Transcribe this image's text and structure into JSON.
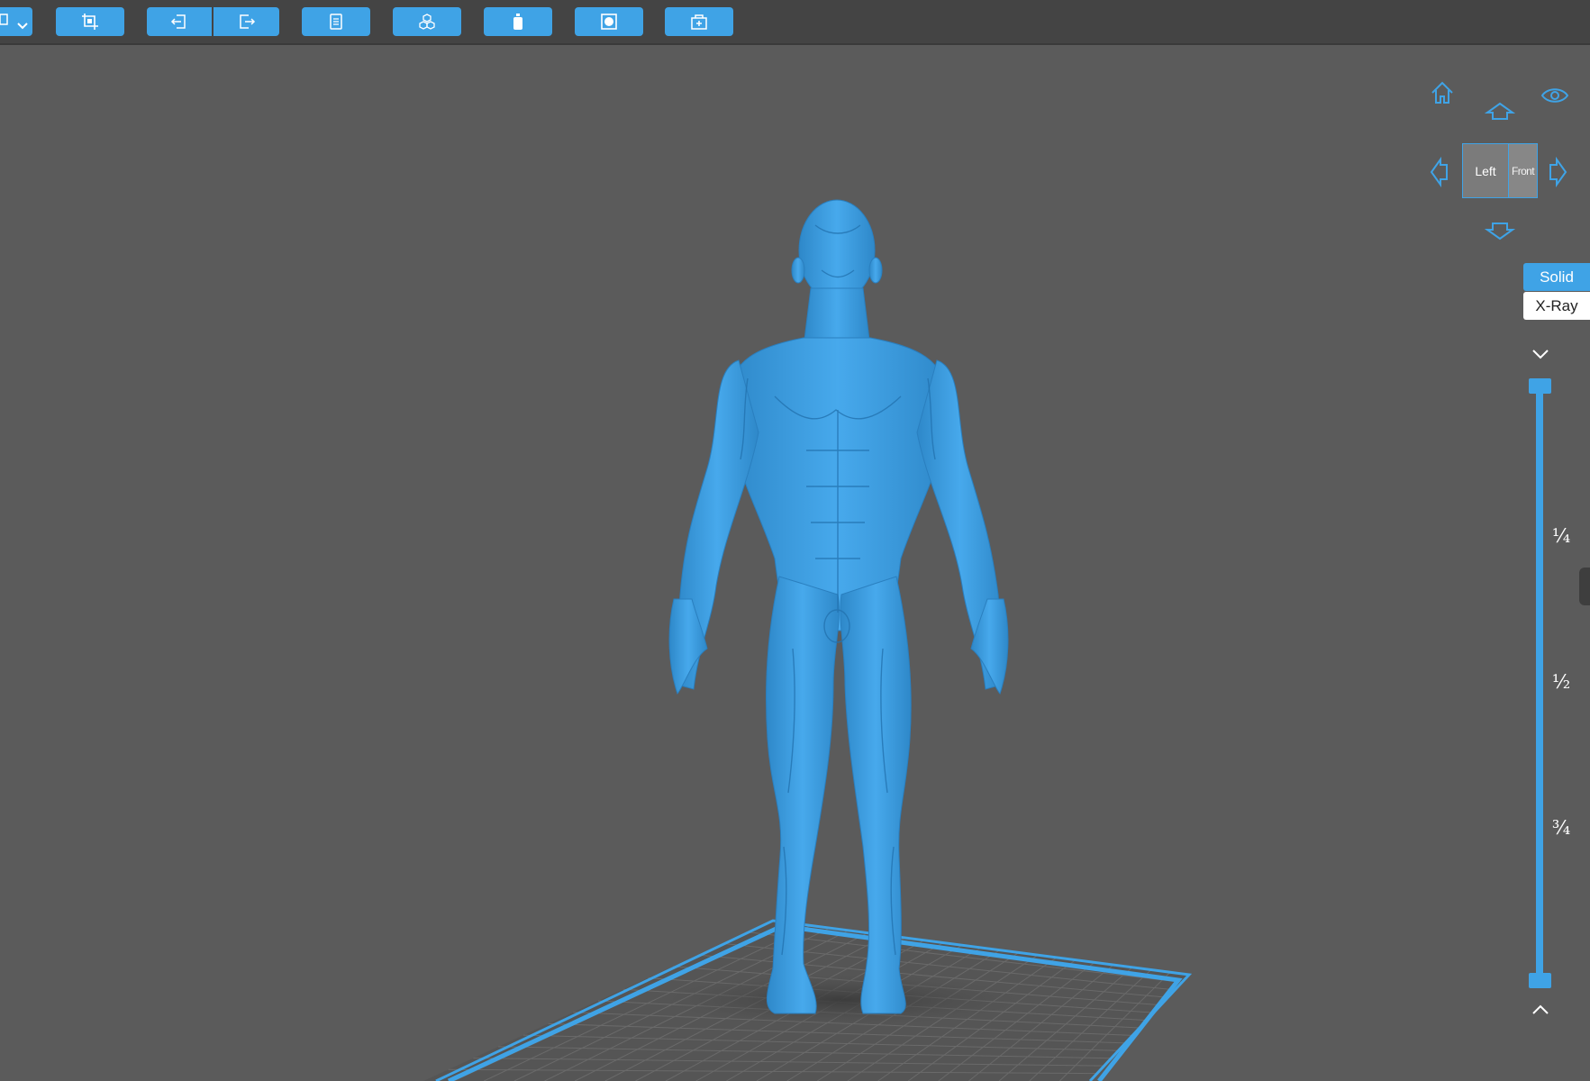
{
  "colors": {
    "accent": "#3fa3e6",
    "toolbar_bg": "#444444",
    "viewport_bg": "#5b5b5b",
    "model": "#3b9fe0"
  },
  "toolbar": {
    "buttons": [
      {
        "name": "file-menu",
        "icon": "file-dropdown-icon"
      },
      {
        "name": "auto-layout",
        "icon": "crop-layout-icon"
      },
      {
        "name": "import",
        "icon": "import-icon"
      },
      {
        "name": "export",
        "icon": "export-icon"
      },
      {
        "name": "slice-list",
        "icon": "document-list-icon"
      },
      {
        "name": "supports",
        "icon": "cubes-icon"
      },
      {
        "name": "resin",
        "icon": "bottle-icon"
      },
      {
        "name": "hollow",
        "icon": "square-hole-icon"
      },
      {
        "name": "add-component",
        "icon": "box-plus-icon"
      }
    ]
  },
  "view_cube": {
    "left_face": "Left",
    "front_face": "Front"
  },
  "render_mode": {
    "solid_label": "Solid",
    "xray_label": "X-Ray",
    "selected": "Solid"
  },
  "layer_slider": {
    "tick_quarter": "¼",
    "tick_half": "½",
    "tick_three_quarter": "¾",
    "top_value": 1.0,
    "bottom_value": 0.0
  }
}
